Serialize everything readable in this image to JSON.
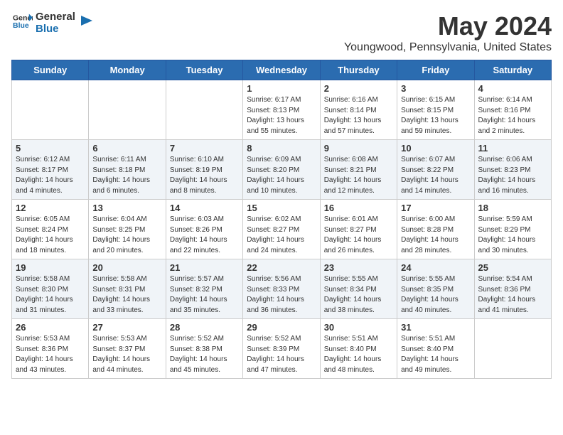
{
  "header": {
    "logo_line1": "General",
    "logo_line2": "Blue",
    "month_title": "May 2024",
    "location": "Youngwood, Pennsylvania, United States"
  },
  "days_of_week": [
    "Sunday",
    "Monday",
    "Tuesday",
    "Wednesday",
    "Thursday",
    "Friday",
    "Saturday"
  ],
  "weeks": [
    [
      {
        "day": "",
        "info": ""
      },
      {
        "day": "",
        "info": ""
      },
      {
        "day": "",
        "info": ""
      },
      {
        "day": "1",
        "info": "Sunrise: 6:17 AM\nSunset: 8:13 PM\nDaylight: 13 hours\nand 55 minutes."
      },
      {
        "day": "2",
        "info": "Sunrise: 6:16 AM\nSunset: 8:14 PM\nDaylight: 13 hours\nand 57 minutes."
      },
      {
        "day": "3",
        "info": "Sunrise: 6:15 AM\nSunset: 8:15 PM\nDaylight: 13 hours\nand 59 minutes."
      },
      {
        "day": "4",
        "info": "Sunrise: 6:14 AM\nSunset: 8:16 PM\nDaylight: 14 hours\nand 2 minutes."
      }
    ],
    [
      {
        "day": "5",
        "info": "Sunrise: 6:12 AM\nSunset: 8:17 PM\nDaylight: 14 hours\nand 4 minutes."
      },
      {
        "day": "6",
        "info": "Sunrise: 6:11 AM\nSunset: 8:18 PM\nDaylight: 14 hours\nand 6 minutes."
      },
      {
        "day": "7",
        "info": "Sunrise: 6:10 AM\nSunset: 8:19 PM\nDaylight: 14 hours\nand 8 minutes."
      },
      {
        "day": "8",
        "info": "Sunrise: 6:09 AM\nSunset: 8:20 PM\nDaylight: 14 hours\nand 10 minutes."
      },
      {
        "day": "9",
        "info": "Sunrise: 6:08 AM\nSunset: 8:21 PM\nDaylight: 14 hours\nand 12 minutes."
      },
      {
        "day": "10",
        "info": "Sunrise: 6:07 AM\nSunset: 8:22 PM\nDaylight: 14 hours\nand 14 minutes."
      },
      {
        "day": "11",
        "info": "Sunrise: 6:06 AM\nSunset: 8:23 PM\nDaylight: 14 hours\nand 16 minutes."
      }
    ],
    [
      {
        "day": "12",
        "info": "Sunrise: 6:05 AM\nSunset: 8:24 PM\nDaylight: 14 hours\nand 18 minutes."
      },
      {
        "day": "13",
        "info": "Sunrise: 6:04 AM\nSunset: 8:25 PM\nDaylight: 14 hours\nand 20 minutes."
      },
      {
        "day": "14",
        "info": "Sunrise: 6:03 AM\nSunset: 8:26 PM\nDaylight: 14 hours\nand 22 minutes."
      },
      {
        "day": "15",
        "info": "Sunrise: 6:02 AM\nSunset: 8:27 PM\nDaylight: 14 hours\nand 24 minutes."
      },
      {
        "day": "16",
        "info": "Sunrise: 6:01 AM\nSunset: 8:27 PM\nDaylight: 14 hours\nand 26 minutes."
      },
      {
        "day": "17",
        "info": "Sunrise: 6:00 AM\nSunset: 8:28 PM\nDaylight: 14 hours\nand 28 minutes."
      },
      {
        "day": "18",
        "info": "Sunrise: 5:59 AM\nSunset: 8:29 PM\nDaylight: 14 hours\nand 30 minutes."
      }
    ],
    [
      {
        "day": "19",
        "info": "Sunrise: 5:58 AM\nSunset: 8:30 PM\nDaylight: 14 hours\nand 31 minutes."
      },
      {
        "day": "20",
        "info": "Sunrise: 5:58 AM\nSunset: 8:31 PM\nDaylight: 14 hours\nand 33 minutes."
      },
      {
        "day": "21",
        "info": "Sunrise: 5:57 AM\nSunset: 8:32 PM\nDaylight: 14 hours\nand 35 minutes."
      },
      {
        "day": "22",
        "info": "Sunrise: 5:56 AM\nSunset: 8:33 PM\nDaylight: 14 hours\nand 36 minutes."
      },
      {
        "day": "23",
        "info": "Sunrise: 5:55 AM\nSunset: 8:34 PM\nDaylight: 14 hours\nand 38 minutes."
      },
      {
        "day": "24",
        "info": "Sunrise: 5:55 AM\nSunset: 8:35 PM\nDaylight: 14 hours\nand 40 minutes."
      },
      {
        "day": "25",
        "info": "Sunrise: 5:54 AM\nSunset: 8:36 PM\nDaylight: 14 hours\nand 41 minutes."
      }
    ],
    [
      {
        "day": "26",
        "info": "Sunrise: 5:53 AM\nSunset: 8:36 PM\nDaylight: 14 hours\nand 43 minutes."
      },
      {
        "day": "27",
        "info": "Sunrise: 5:53 AM\nSunset: 8:37 PM\nDaylight: 14 hours\nand 44 minutes."
      },
      {
        "day": "28",
        "info": "Sunrise: 5:52 AM\nSunset: 8:38 PM\nDaylight: 14 hours\nand 45 minutes."
      },
      {
        "day": "29",
        "info": "Sunrise: 5:52 AM\nSunset: 8:39 PM\nDaylight: 14 hours\nand 47 minutes."
      },
      {
        "day": "30",
        "info": "Sunrise: 5:51 AM\nSunset: 8:40 PM\nDaylight: 14 hours\nand 48 minutes."
      },
      {
        "day": "31",
        "info": "Sunrise: 5:51 AM\nSunset: 8:40 PM\nDaylight: 14 hours\nand 49 minutes."
      },
      {
        "day": "",
        "info": ""
      }
    ]
  ]
}
